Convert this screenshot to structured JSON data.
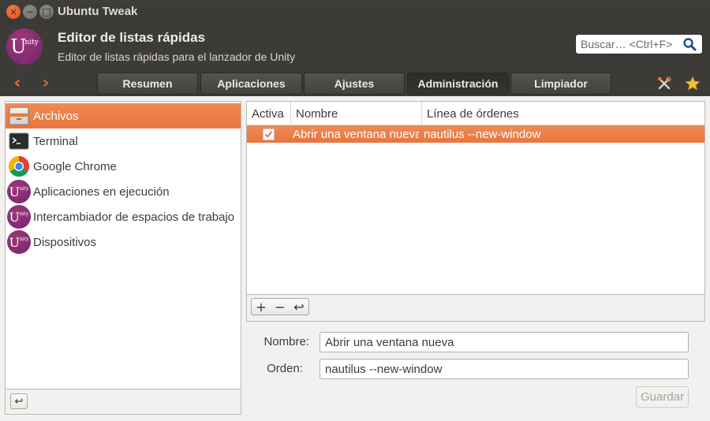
{
  "window": {
    "title": "Ubuntu Tweak",
    "controls": {
      "close": "×",
      "minimize": "−",
      "maximize": "□"
    }
  },
  "header": {
    "logo_icon": "unity-logo-icon",
    "title": "Editor de listas rápidas",
    "subtitle": "Editor de listas rápidas para el lanzador de Unity",
    "search_placeholder": "Buscar… <Ctrl+F>"
  },
  "toolbar": {
    "back_glyph": "‹",
    "forward_glyph": "›",
    "tabs": [
      {
        "label": "Resumen",
        "active": false
      },
      {
        "label": "Aplicaciones",
        "active": false
      },
      {
        "label": "Ajustes",
        "active": false
      },
      {
        "label": "Administración",
        "active": true
      },
      {
        "label": "Limpiador",
        "active": false
      }
    ],
    "right_icons": [
      "tools-icon",
      "star-icon"
    ]
  },
  "sidebar": {
    "items": [
      {
        "label": "Archivos",
        "icon": "file-manager-icon",
        "selected": true
      },
      {
        "label": "Terminal",
        "icon": "terminal-icon",
        "selected": false
      },
      {
        "label": "Google Chrome",
        "icon": "chrome-icon",
        "selected": false
      },
      {
        "label": "Aplicaciones en ejecución",
        "icon": "unity-logo-icon",
        "selected": false
      },
      {
        "label": "Intercambiador de espacios de trabajo",
        "icon": "unity-logo-icon",
        "selected": false
      },
      {
        "label": "Dispositivos",
        "icon": "unity-logo-icon",
        "selected": false
      }
    ],
    "unity_glyph": "U",
    "unity_small": "nity",
    "footer_button_glyph": "↩"
  },
  "table": {
    "columns": [
      "Activa",
      "Nombre",
      "Línea de órdenes"
    ],
    "rows": [
      {
        "active": true,
        "name": "Abrir una ventana nueva",
        "command": "nautilus --new-window"
      }
    ],
    "bar_buttons": [
      "+",
      "−",
      "↩"
    ]
  },
  "form": {
    "name_label": "Nombre:",
    "name_value": "Abrir una ventana nueva",
    "command_label": "Orden:",
    "command_value": "nautilus --new-window",
    "save_label": "Guardar"
  },
  "colors": {
    "accent": "#e8753e",
    "header_bg": "#3c3b37",
    "unity_purple": "#77216f"
  }
}
